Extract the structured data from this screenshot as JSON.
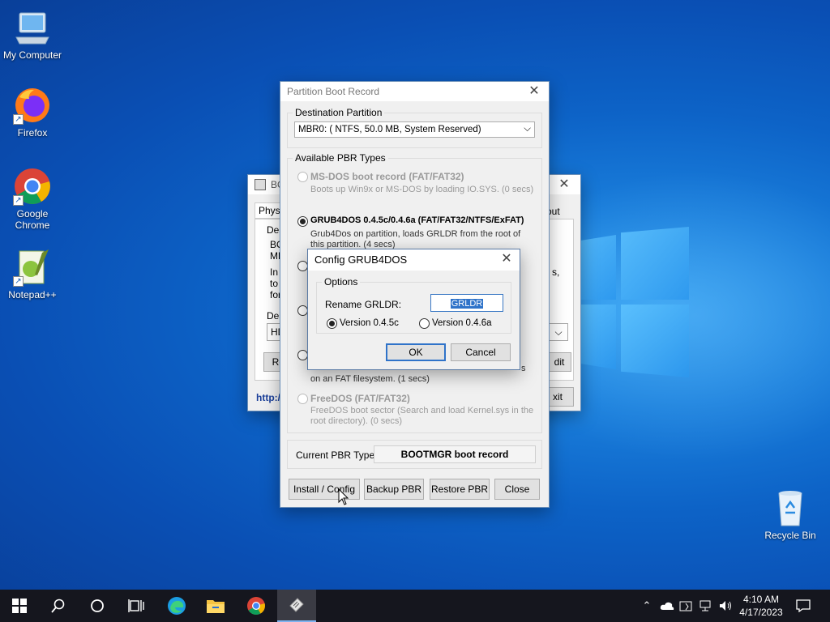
{
  "desktop": {
    "icons": [
      {
        "label": "My Computer"
      },
      {
        "label": "Firefox"
      },
      {
        "label": "Google Chrome"
      },
      {
        "label": "Notepad++"
      },
      {
        "label": "Recycle Bin"
      }
    ]
  },
  "bg_window": {
    "title": "BO",
    "tab1": "Physi",
    "tab_right": "out",
    "desc_label": "Des",
    "text1": "BO",
    "text2": "ME",
    "text3": "In",
    "text4": "to",
    "text5": "for",
    "dest_label": "Des",
    "hd": "HD",
    "refresh": "Ref",
    "edit": "dit",
    "link": "http:/",
    "exit": "xit",
    "right_comma": "s,"
  },
  "pbr": {
    "title": "Partition Boot Record",
    "dest_group": "Destination Partition",
    "dest_value": "MBR0: ( NTFS,  50.0 MB, System Reserved)",
    "types_group": "Available PBR Types",
    "types": [
      {
        "name": "MS-DOS boot record (FAT/FAT32)",
        "desc": "Boots up Win9x or MS-DOS by loading IO.SYS. (0 secs)"
      },
      {
        "name": "GRUB4DOS 0.4.5c/0.4.6a (FAT/FAT32/NTFS/ExFAT)",
        "desc1": "Grub4Dos on partition, loads GRLDR from the root of",
        "desc2": "this partition. (4 secs)"
      },
      {
        "desc_tail": "on an FAT filesystem. (1 secs)",
        "desc_right": "s"
      },
      {
        "name": "FreeDOS (FAT/FAT32)",
        "desc1": "FreeDOS boot sector (Search and load Kernel.sys in the",
        "desc2": "root directory). (0 secs)"
      }
    ],
    "current_label": "Current PBR Type:",
    "current_value": "BOOTMGR boot record",
    "buttons": {
      "install": "Install / Config",
      "backup": "Backup PBR",
      "restore": "Restore PBR",
      "close": "Close"
    }
  },
  "grub_dialog": {
    "title": "Config GRUB4DOS",
    "options_group": "Options",
    "rename_label": "Rename GRLDR:",
    "rename_value": "GRLDR",
    "version1": "Version 0.4.5c",
    "version2": "Version 0.4.6a",
    "ok": "OK",
    "cancel": "Cancel"
  },
  "taskbar": {
    "time": "4:10 AM",
    "date": "4/17/2023"
  }
}
